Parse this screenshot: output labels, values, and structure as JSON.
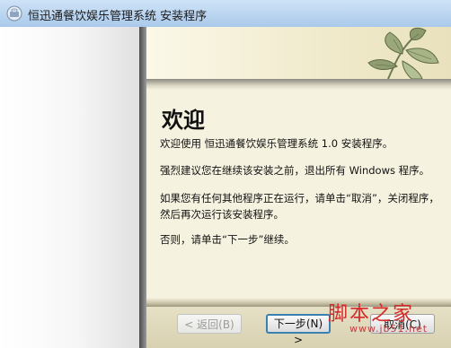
{
  "window": {
    "title": "恒迅通餐饮娱乐管理系统 安装程序"
  },
  "page": {
    "heading": "欢迎",
    "paragraphs": [
      "欢迎使用 恒迅通餐饮娱乐管理系统 1.0 安装程序。",
      "强烈建议您在继续该安装之前，退出所有 Windows 程序。",
      "如果您有任何其他程序正在运行，请单击“取消”，关闭程序，然后再次运行该安装程序。",
      "否则，请单击“下一步”继续。"
    ]
  },
  "buttons": {
    "back": "< 返回(B)",
    "next": "下一步(N) >",
    "cancel": "取消(C)"
  },
  "watermark": {
    "text": "脚本之家",
    "url": "www.jb51.net"
  },
  "colors": {
    "title_bar": "#aac9ea",
    "content_bg": "#f6f2e0",
    "footer_bg": "#ddd6b6",
    "default_button_border": "#3c7fb1",
    "watermark": "#d42a2a"
  },
  "icons": [
    "app-icon",
    "leaf-decoration"
  ]
}
